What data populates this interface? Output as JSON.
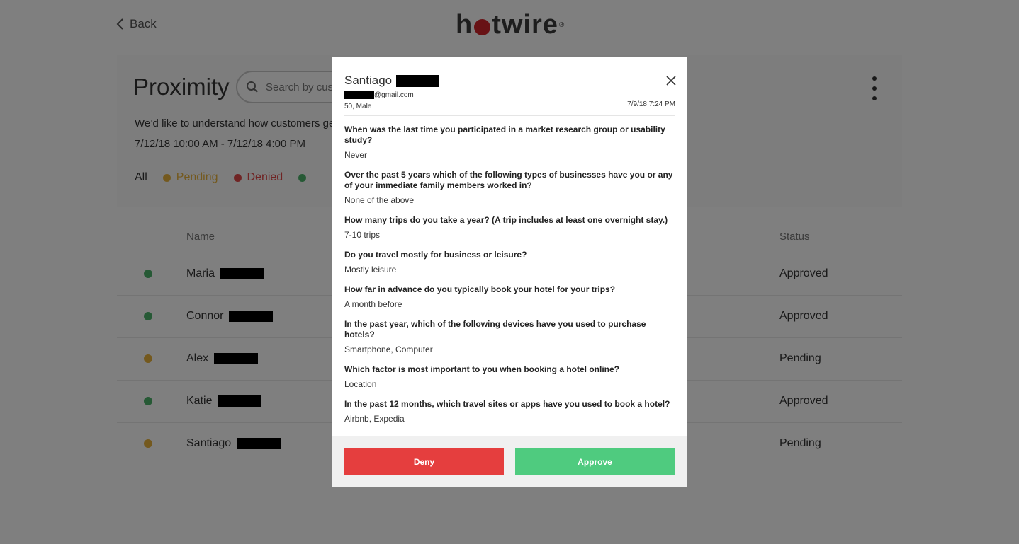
{
  "header": {
    "back_label": "Back",
    "logo_pre": "h",
    "logo_post": "twire",
    "logo_reg": "®"
  },
  "page": {
    "title": "Proximity",
    "search_placeholder": "Search by customer",
    "description": "We’d like to understand how customers ge",
    "date_range": "7/12/18 10:00 AM - 7/12/18 4:00 PM",
    "filters": [
      {
        "label": "All",
        "color": "",
        "text_color": "#333333"
      },
      {
        "label": "Pending",
        "color": "#e8b33c",
        "text_color": "#e8b33c"
      },
      {
        "label": "Denied",
        "color": "#e04848",
        "text_color": "#e04848"
      },
      {
        "label": "",
        "color": "#4cb36a",
        "text_color": "#4cb36a"
      }
    ]
  },
  "table": {
    "col_name": "Name",
    "col_status": "Status",
    "rows": [
      {
        "name": "Maria",
        "status": "Approved",
        "status_color": "#4cb36a"
      },
      {
        "name": "Connor",
        "status": "Approved",
        "status_color": "#4cb36a"
      },
      {
        "name": "Alex",
        "status": "Pending",
        "status_color": "#e8b33c"
      },
      {
        "name": "Katie",
        "status": "Approved",
        "status_color": "#4cb36a"
      },
      {
        "name": "Santiago",
        "status": "Pending",
        "status_color": "#e8b33c"
      }
    ]
  },
  "modal": {
    "first_name": "Santiago",
    "email_suffix": "@gmail.com",
    "demographics": "50, Male",
    "submitted": "7/9/18 7:24 PM",
    "qa": [
      {
        "q": "When was the last time you participated in a market research group or usability study?",
        "a": "Never"
      },
      {
        "q": "Over the past 5 years which of the following types of businesses have you or any of your immediate family members worked in?",
        "a": "None of the above"
      },
      {
        "q": "How many trips do you take a year? (A trip includes at least one overnight stay.)",
        "a": "7-10 trips"
      },
      {
        "q": "Do you travel mostly for business or leisure?",
        "a": "Mostly leisure"
      },
      {
        "q": "How far in advance do you typically book your hotel for your trips?",
        "a": "A month before"
      },
      {
        "q": "In the past year, which of the following devices have you used to purchase hotels?",
        "a": "Smartphone, Computer"
      },
      {
        "q": "Which factor is most important to you when booking a hotel online?",
        "a": "Location"
      },
      {
        "q": "In the past 12 months, which travel sites or apps have you used to book a hotel?",
        "a": "Airbnb, Expedia"
      }
    ],
    "deny_label": "Deny",
    "approve_label": "Approve",
    "deny_color": "#e53e3e",
    "approve_color": "#4fcb7f"
  }
}
